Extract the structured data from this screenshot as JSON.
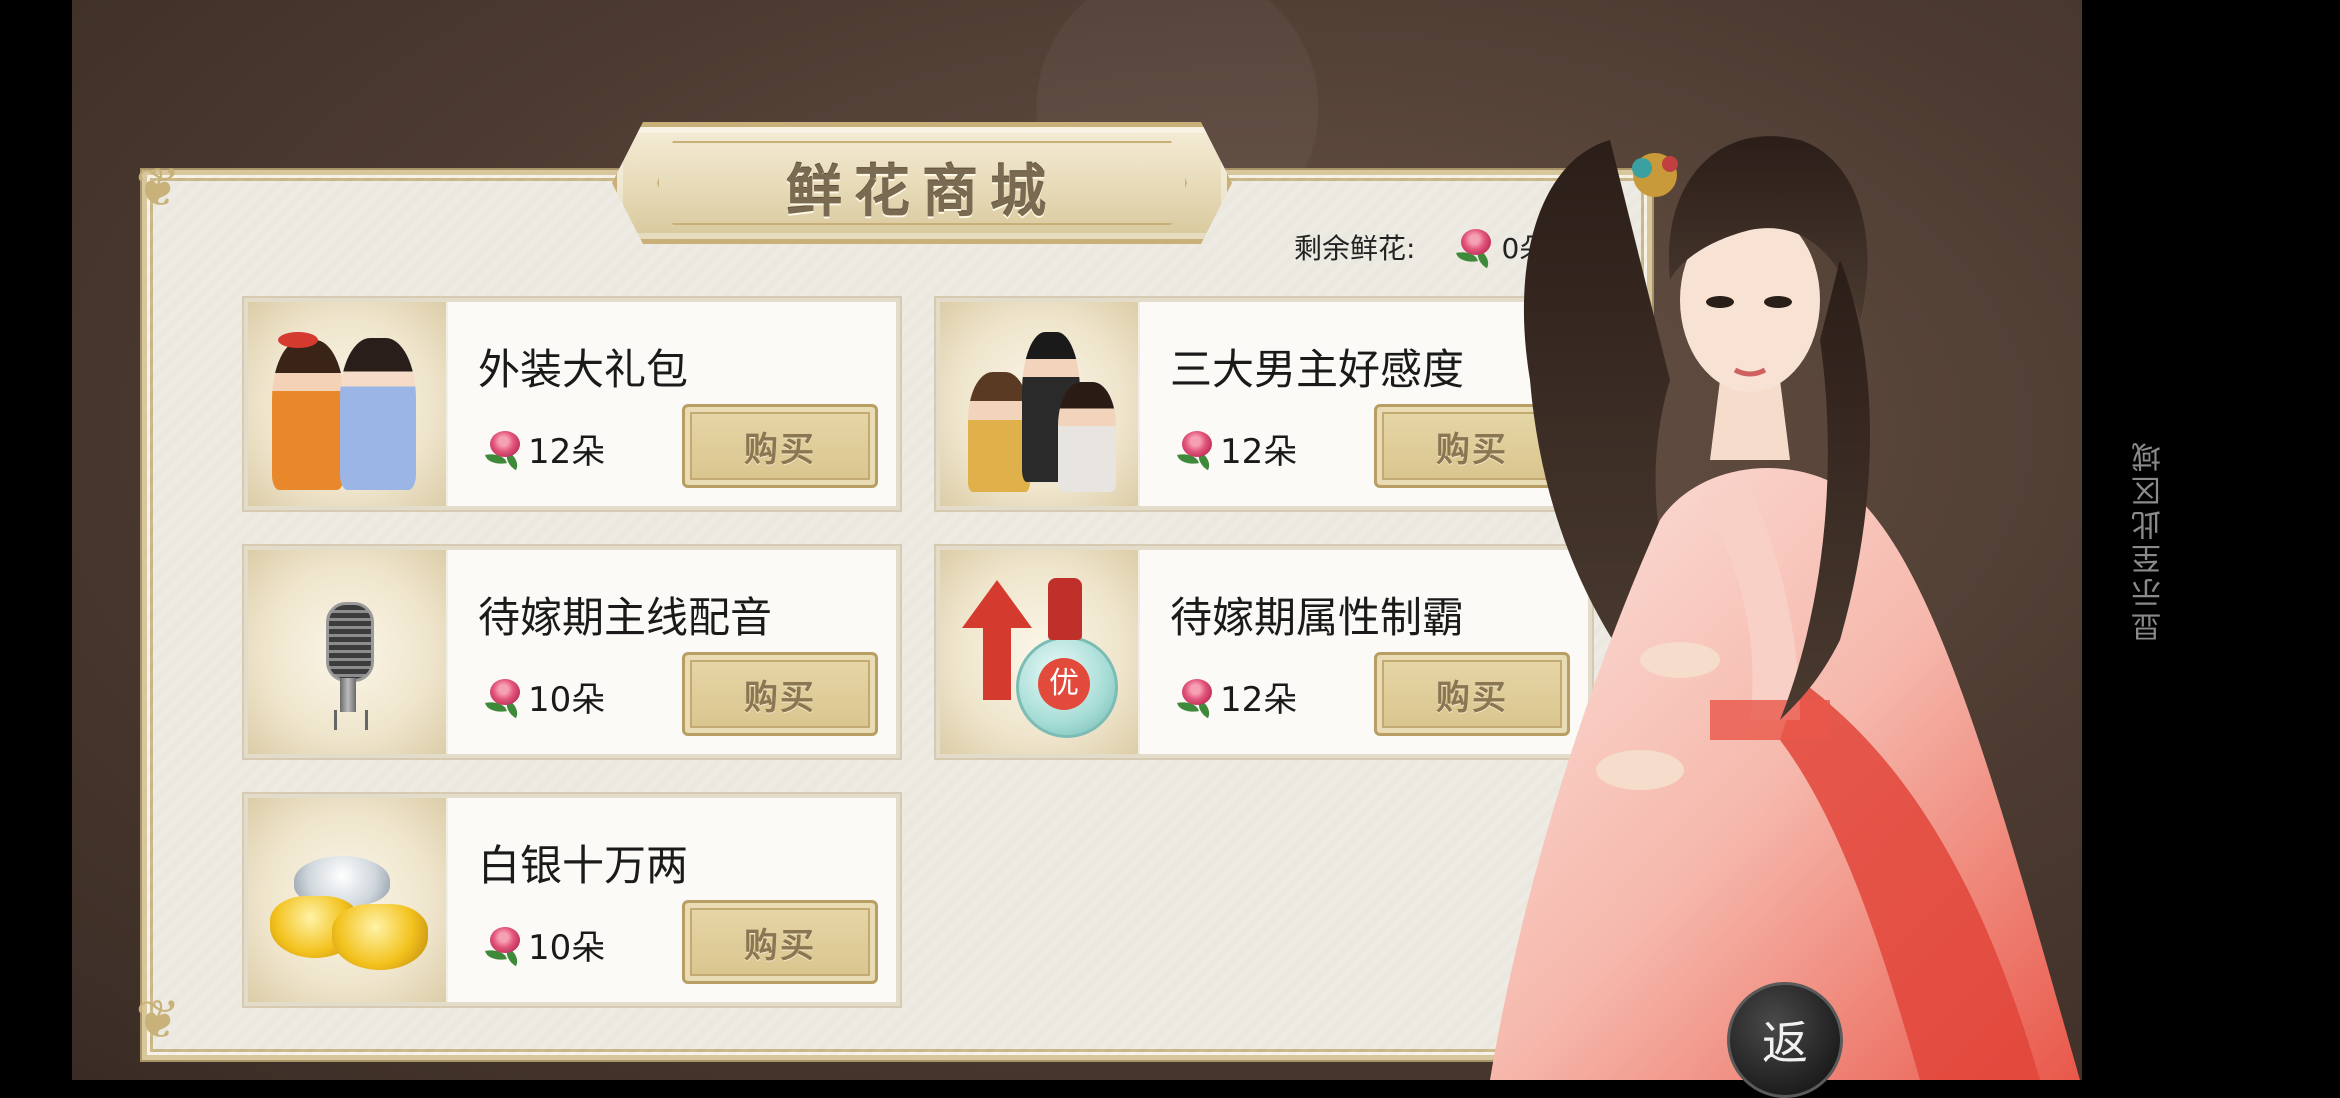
{
  "title": "鲜花商城",
  "remaining": {
    "label": "剩余鲜花:",
    "value": "0朵"
  },
  "items": [
    {
      "name": "外装大礼包",
      "price": "12朵",
      "buy_label": "购买"
    },
    {
      "name": "三大男主好感度",
      "price": "12朵",
      "buy_label": "购买"
    },
    {
      "name": "待嫁期主线配音",
      "price": "10朵",
      "buy_label": "购买"
    },
    {
      "name": "待嫁期属性制霸",
      "price": "12朵",
      "buy_label": "购买"
    },
    {
      "name": "白银十万两",
      "price": "10朵",
      "buy_label": "购买"
    }
  ],
  "back_label": "返",
  "side_note": "显示至此区域",
  "colors": {
    "accent_gold": "#d8c48c",
    "rose": "#e2557c"
  }
}
